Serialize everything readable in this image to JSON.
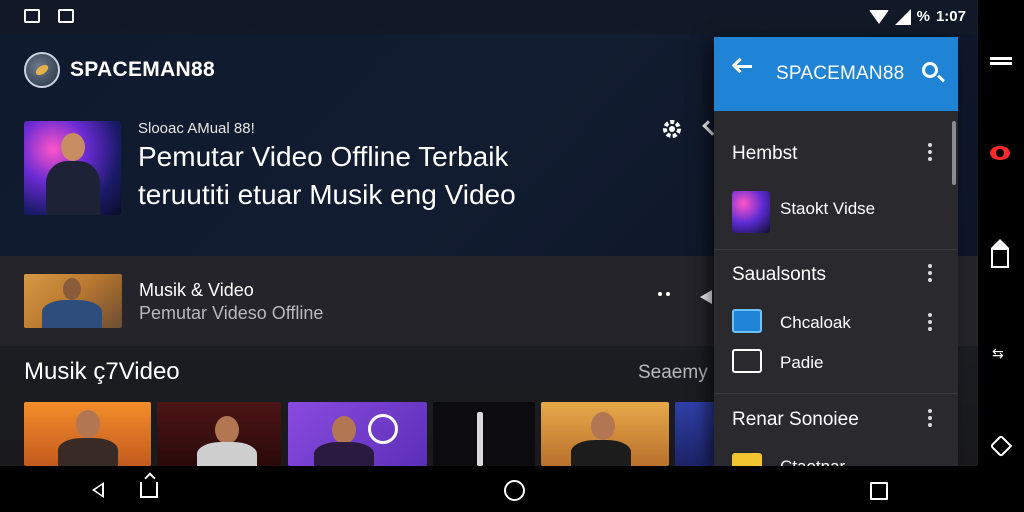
{
  "status_bar": {
    "battery_text": "%",
    "time": "1:07"
  },
  "app": {
    "title": "SPACEMAN88"
  },
  "hero": {
    "subtitle": "Slooac AMual 88!",
    "title_line1": "Pemutar Video Offline Terbaik",
    "title_line2": "teruutiti etuar Musik eng Video"
  },
  "list_row": {
    "title": "Musik & Video",
    "subtitle": "Pemutar Videso Offline"
  },
  "section": {
    "heading": "Musik ç7Video",
    "see_all": "Seaemy"
  },
  "drawer": {
    "title": "SPACEMAN88",
    "items": [
      {
        "type": "header",
        "label": "Hembst"
      },
      {
        "type": "item",
        "label": "Staokt Vidse"
      },
      {
        "type": "header",
        "label": "Saualsonts"
      },
      {
        "type": "item",
        "label": "Chcaloak"
      },
      {
        "type": "item",
        "label": "Padie"
      },
      {
        "type": "header",
        "label": "Renar Sonoiee"
      },
      {
        "type": "item",
        "label": "Ctaotnar"
      }
    ]
  },
  "colors": {
    "accent": "#1f84d6",
    "drawer_bg": "#2a2a2e",
    "background": "#151c2b"
  },
  "icons": [
    "gear-icon",
    "search-icon",
    "back-arrow-icon",
    "kebab-icon",
    "home-icon",
    "recents-icon"
  ]
}
